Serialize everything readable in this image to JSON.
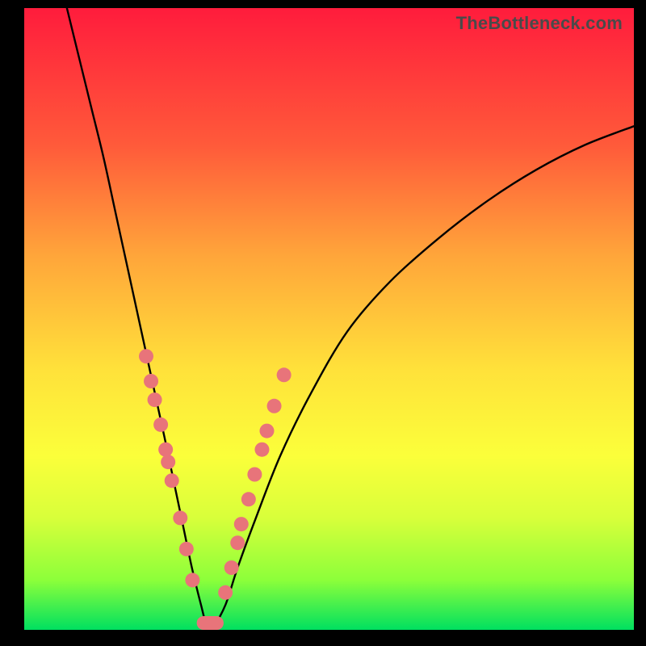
{
  "watermark": "TheBottleneck.com",
  "chart_data": {
    "type": "line",
    "title": "",
    "xlabel": "",
    "ylabel": "",
    "xlim": [
      0,
      100
    ],
    "ylim": [
      0,
      100
    ],
    "grid": false,
    "legend": false,
    "series": [
      {
        "name": "bottleneck-curve",
        "color": "#000000",
        "x": [
          7,
          9,
          11,
          13,
          15,
          17,
          19,
          21,
          23,
          24.5,
          26,
          27.5,
          29,
          30,
          31,
          33,
          35,
          38,
          42,
          47,
          53,
          60,
          68,
          76,
          84,
          92,
          100
        ],
        "y": [
          100,
          92,
          84,
          76,
          67,
          58,
          49,
          40,
          31,
          24,
          17,
          10,
          4,
          0.5,
          0.5,
          4,
          10,
          18,
          28,
          38,
          48,
          56,
          63,
          69,
          74,
          78,
          81
        ]
      }
    ],
    "markers": [
      {
        "series": "left-dots",
        "color": "#e8747a",
        "r": 9,
        "points": [
          {
            "x": 20.0,
            "y": 44
          },
          {
            "x": 20.8,
            "y": 40
          },
          {
            "x": 21.4,
            "y": 37
          },
          {
            "x": 22.4,
            "y": 33
          },
          {
            "x": 23.2,
            "y": 29
          },
          {
            "x": 23.6,
            "y": 27
          },
          {
            "x": 24.2,
            "y": 24
          },
          {
            "x": 25.6,
            "y": 18
          },
          {
            "x": 26.6,
            "y": 13
          },
          {
            "x": 27.6,
            "y": 8
          }
        ]
      },
      {
        "series": "right-dots",
        "color": "#e8747a",
        "r": 9,
        "points": [
          {
            "x": 33.0,
            "y": 6
          },
          {
            "x": 34.0,
            "y": 10
          },
          {
            "x": 35.0,
            "y": 14
          },
          {
            "x": 35.6,
            "y": 17
          },
          {
            "x": 36.8,
            "y": 21
          },
          {
            "x": 37.8,
            "y": 25
          },
          {
            "x": 39.0,
            "y": 29
          },
          {
            "x": 39.8,
            "y": 32
          },
          {
            "x": 41.0,
            "y": 36
          },
          {
            "x": 42.6,
            "y": 41
          }
        ]
      },
      {
        "series": "bottom-bar",
        "color": "#e8747a",
        "rect": {
          "x": 28.3,
          "y": 0.0,
          "w": 4.4,
          "h": 2.2,
          "rx": 1.1
        }
      }
    ]
  }
}
